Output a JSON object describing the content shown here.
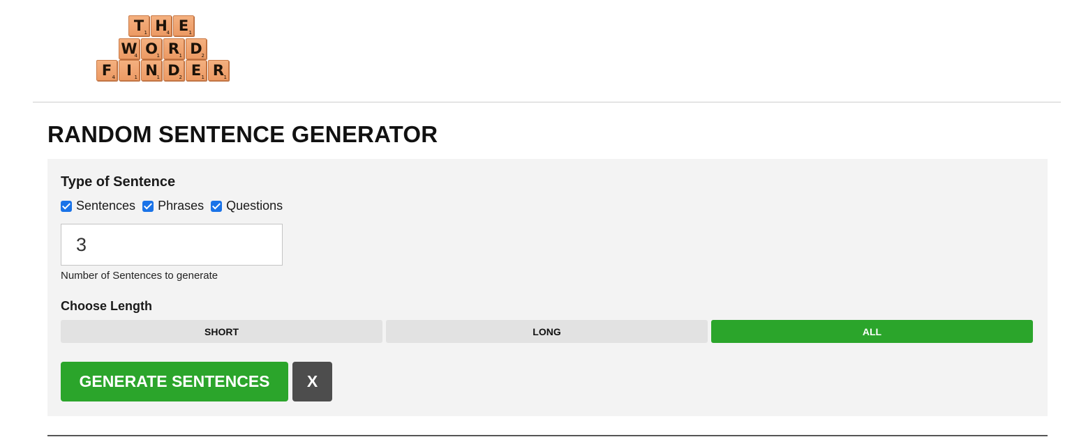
{
  "logo": {
    "rows": [
      [
        {
          "letter": "T",
          "points": "1"
        },
        {
          "letter": "H",
          "points": "4"
        },
        {
          "letter": "E",
          "points": "1"
        }
      ],
      [
        {
          "letter": "W",
          "points": "4"
        },
        {
          "letter": "O",
          "points": "1"
        },
        {
          "letter": "R",
          "points": "1"
        },
        {
          "letter": "D",
          "points": "2"
        }
      ],
      [
        {
          "letter": "F",
          "points": "4"
        },
        {
          "letter": "I",
          "points": "1"
        },
        {
          "letter": "N",
          "points": "1"
        },
        {
          "letter": "D",
          "points": "2"
        },
        {
          "letter": "E",
          "points": "1"
        },
        {
          "letter": "R",
          "points": "1"
        }
      ]
    ]
  },
  "page": {
    "title": "RANDOM SENTENCE GENERATOR"
  },
  "form": {
    "type_label": "Type of Sentence",
    "checkboxes": [
      {
        "label": "Sentences",
        "checked": true
      },
      {
        "label": "Phrases",
        "checked": true
      },
      {
        "label": "Questions",
        "checked": true
      }
    ],
    "count_value": "3",
    "count_hint": "Number of Sentences to generate",
    "length_label": "Choose Length",
    "length_options": [
      {
        "label": "SHORT",
        "selected": false
      },
      {
        "label": "LONG",
        "selected": false
      },
      {
        "label": "ALL",
        "selected": true
      }
    ],
    "generate_label": "GENERATE SENTENCES",
    "clear_label": "X"
  },
  "colors": {
    "accent_green": "#2ba52b",
    "checkbox_blue": "#1a73e8",
    "panel_bg": "#f3f3f3",
    "clear_button": "#4d4d4d"
  }
}
